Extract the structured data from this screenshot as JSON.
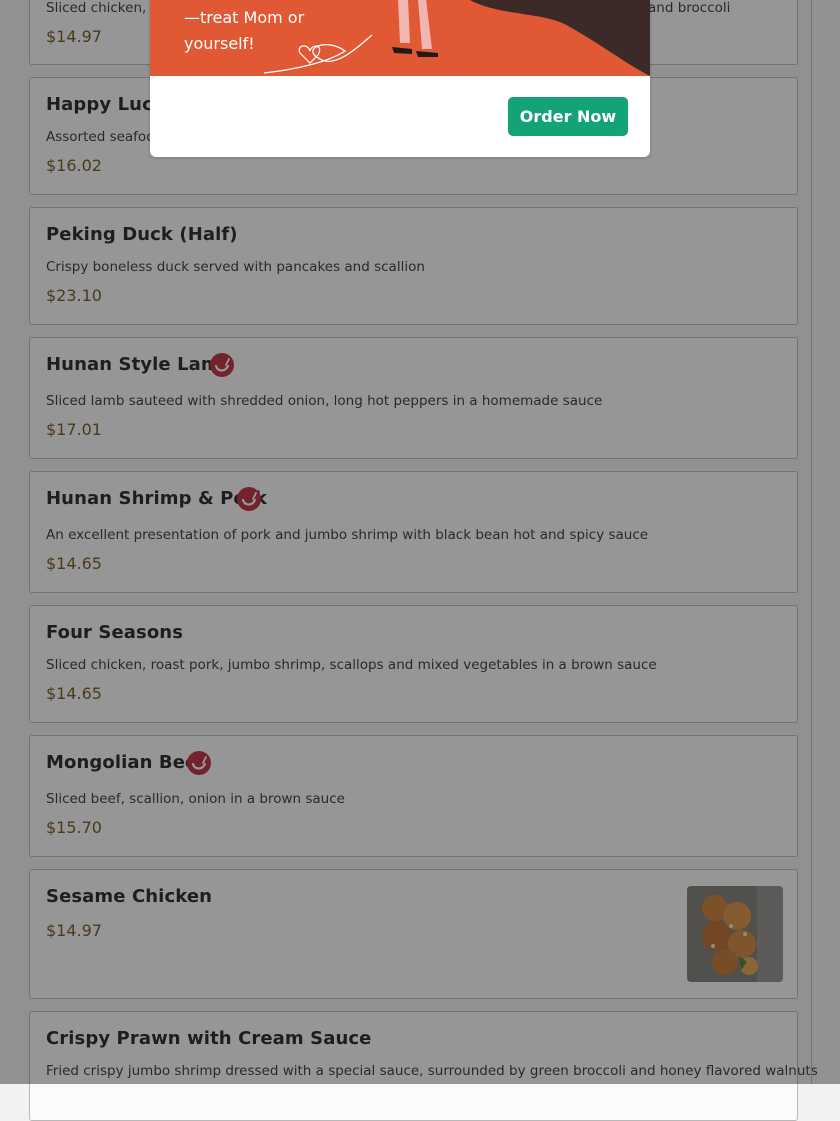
{
  "menu": {
    "items": [
      {
        "name": "",
        "description": "Sliced chicken, b",
        "description_tail": "and broccoli",
        "price": "$14.97"
      },
      {
        "name": "Happy Lucky",
        "description": "Assorted seafoo",
        "price": "$16.02"
      },
      {
        "name": "Peking Duck (Half)",
        "description": "Crispy boneless duck served with pancakes and scallion",
        "price": "$23.10"
      },
      {
        "name": "Hunan Style Lamb",
        "spicy": true,
        "description": "Sliced lamb sauteed with shredded onion, long hot peppers in a homemade sauce",
        "price": "$17.01"
      },
      {
        "name": "Hunan Shrimp & Pork",
        "spicy": true,
        "description": "An excellent presentation of pork and jumbo shrimp with black bean hot and spicy sauce",
        "price": "$14.65"
      },
      {
        "name": "Four Seasons",
        "description": "Sliced chicken, roast pork, jumbo shrimp, scallops and mixed vegetables in a brown sauce",
        "price": "$14.65"
      },
      {
        "name": "Mongolian Beef",
        "spicy": true,
        "description": "Sliced beef, scallion, onion in a brown sauce",
        "price": "$15.70"
      },
      {
        "name": "Sesame Chicken",
        "price": "$14.97",
        "has_photo": true
      },
      {
        "name": "Crispy Prawn with Cream Sauce",
        "description": "Fried crispy jumbo shrimp dressed with a special sauce, surrounded by green broccoli and honey flavored walnuts"
      }
    ]
  },
  "promo": {
    "line1": "—treat Mom or",
    "line2": "yourself!",
    "order_button": "Order Now",
    "accent": "#e05834",
    "button_color": "#13a376"
  },
  "icons": {
    "spicy": "chili-pepper-icon"
  }
}
